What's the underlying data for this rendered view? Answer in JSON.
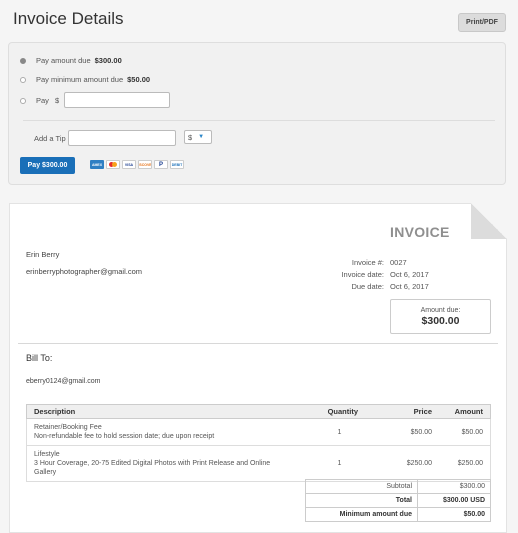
{
  "header": {
    "title": "Invoice Details",
    "print_label": "Print/PDF"
  },
  "payment": {
    "options": [
      {
        "label": "Pay amount due",
        "amount": "$300.00",
        "selected": true
      },
      {
        "label": "Pay minimum amount due",
        "amount": "$50.00",
        "selected": false
      },
      {
        "label": "Pay",
        "prefix": "$",
        "selected": false
      }
    ],
    "pay_input_value": "",
    "tip_label": "Add a Tip",
    "tip_value": "",
    "tip_unit": "$",
    "pay_button": "Pay $300.00",
    "card_icons": [
      "amex-icon",
      "mastercard-icon",
      "visa-icon",
      "discover-icon",
      "paypal-icon",
      "debit-icon"
    ],
    "card_texts": {
      "amex": "AMEX",
      "visa": "VISA",
      "discover": "DISCOVER",
      "paypal": "P",
      "debit": "DEBIT"
    }
  },
  "invoice": {
    "heading": "INVOICE",
    "from_name": "Erin Berry",
    "from_email": "erinberryphotographer@gmail.com",
    "meta": [
      {
        "key": "Invoice #:",
        "value": "0027"
      },
      {
        "key": "Invoice date:",
        "value": "Oct 6, 2017"
      },
      {
        "key": "Due date:",
        "value": "Oct 6, 2017"
      }
    ],
    "amount_due_label": "Amount due:",
    "amount_due_value": "$300.00",
    "bill_to_label": "Bill To:",
    "bill_to_email": "eberry0124@gmail.com",
    "columns": [
      "Description",
      "Quantity",
      "Price",
      "Amount"
    ],
    "items": [
      {
        "title": "Retainer/Booking Fee",
        "detail": "Non-refundable fee to hold session date; due upon receipt",
        "quantity": "1",
        "price": "$50.00",
        "amount": "$50.00"
      },
      {
        "title": "Lifestyle",
        "detail": "3 Hour Coverage, 20-75 Edited Digital Photos with Print Release and Online Gallery",
        "quantity": "1",
        "price": "$250.00",
        "amount": "$250.00"
      }
    ],
    "totals": [
      {
        "label": "Subtotal",
        "value": "$300.00",
        "bold": false
      },
      {
        "label": "Total",
        "value": "$300.00 USD",
        "bold": true
      },
      {
        "label": "Minimum amount due",
        "value": "$50.00",
        "bold": true
      }
    ]
  },
  "colors": {
    "accent": "#1a6fb8",
    "heading_gray": "#8f8f8f"
  }
}
